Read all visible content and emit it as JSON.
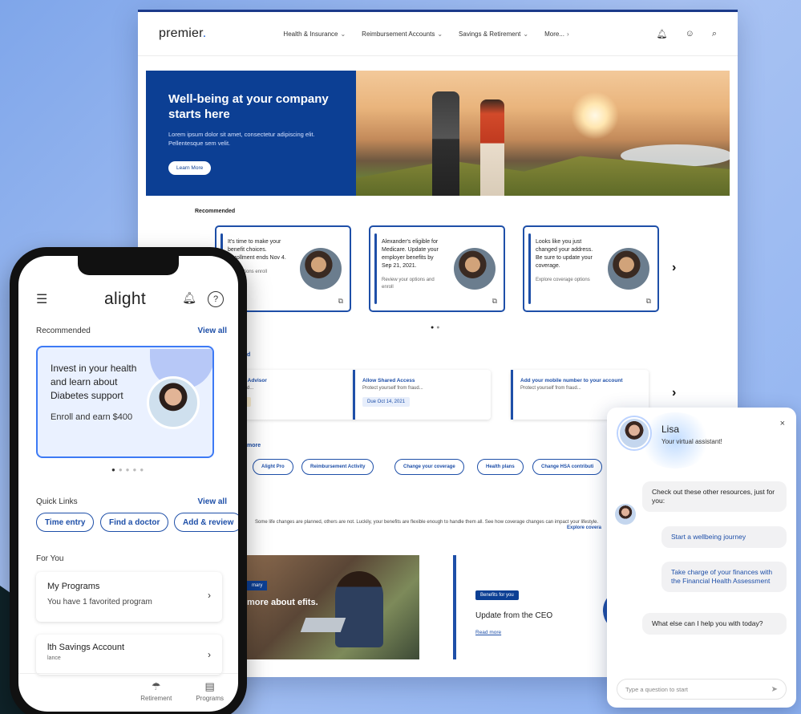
{
  "desktop": {
    "brand": "premier",
    "nav": [
      "Health & Insurance",
      "Reimbursement Accounts",
      "Savings & Retirement",
      "More..."
    ],
    "hero": {
      "title": "Well-being at your company starts here",
      "body": "Lorem ipsum dolor sit amet, consectetur adipiscing elit. Pellentesque sem velit.",
      "button": "Learn More"
    },
    "recommended_label": "Recommended",
    "rec_cards": [
      {
        "text": "It's time to make your benefit choices. Enrollment ends Nov 4.",
        "sub": "your options enroll"
      },
      {
        "text": "Alexander's eligible for Medicare. Update your employer benefits by Sep 21, 2021.",
        "sub": "Review your options and enroll"
      },
      {
        "text": "Looks like you just changed your address. Be sure to update your coverage.",
        "sub": "Explore coverage options"
      }
    ],
    "section_label_1": "d",
    "tasks": [
      {
        "title": "ersonal Advisor",
        "sub": "from fraud...",
        "due": ", 2021"
      },
      {
        "title": "Allow Shared Access",
        "sub": "Protect yourself from fraud...",
        "due": "Due Oct 14, 2021"
      },
      {
        "title": "Add your mobile number to your account",
        "sub": "Protect yourself from fraud..."
      }
    ],
    "section_label_2": "more",
    "pills": [
      "Alight Pro",
      "Reimbursement Activity",
      "Change your coverage",
      "Health plans",
      "Change HSA contributi"
    ],
    "life_changes": "Some life changes are planned, others are not. Luckily, your benefits are flexible enough to handle them all. See how coverage changes can impact your lifestyle.",
    "explore": "Explore covera",
    "photo_card": {
      "tag": "mary",
      "title": "more about efits."
    },
    "ceo_card": {
      "tag": "Benefits for you",
      "title": "Update from the CEO",
      "link": "Read more"
    }
  },
  "phone": {
    "logo": "alight",
    "recommended": "Recommended",
    "view_all": "View all",
    "card": {
      "title": "Invest in your health and learn about Diabetes support",
      "sub": "Enroll and earn $400"
    },
    "quick_links": "Quick Links",
    "view_all_2": "View all",
    "chips": [
      "Time entry",
      "Find a doctor",
      "Add & review"
    ],
    "for_you": "For You",
    "programs": {
      "title": "My Programs",
      "sub": "You have 1 favorited program"
    },
    "hsa": {
      "title": "lth Savings Account",
      "sub": "lance"
    },
    "tabs": [
      "Retirement",
      "Programs"
    ]
  },
  "chat": {
    "name": "Lisa",
    "subtitle": "Your virtual assistant!",
    "messages": [
      {
        "type": "bot",
        "text": "Check out these other resources, just for you:"
      },
      {
        "type": "link",
        "text": "Start a wellbeing journey"
      },
      {
        "type": "link",
        "text": "Take charge of your finances with the Financial Health Assessment"
      },
      {
        "type": "bot",
        "text": "What else can I help you with today?"
      }
    ],
    "input_placeholder": "Type a question to start"
  },
  "colors": {
    "primary": "#0c3f94",
    "accent": "#1e4fa8",
    "background": "#8db1f0"
  }
}
